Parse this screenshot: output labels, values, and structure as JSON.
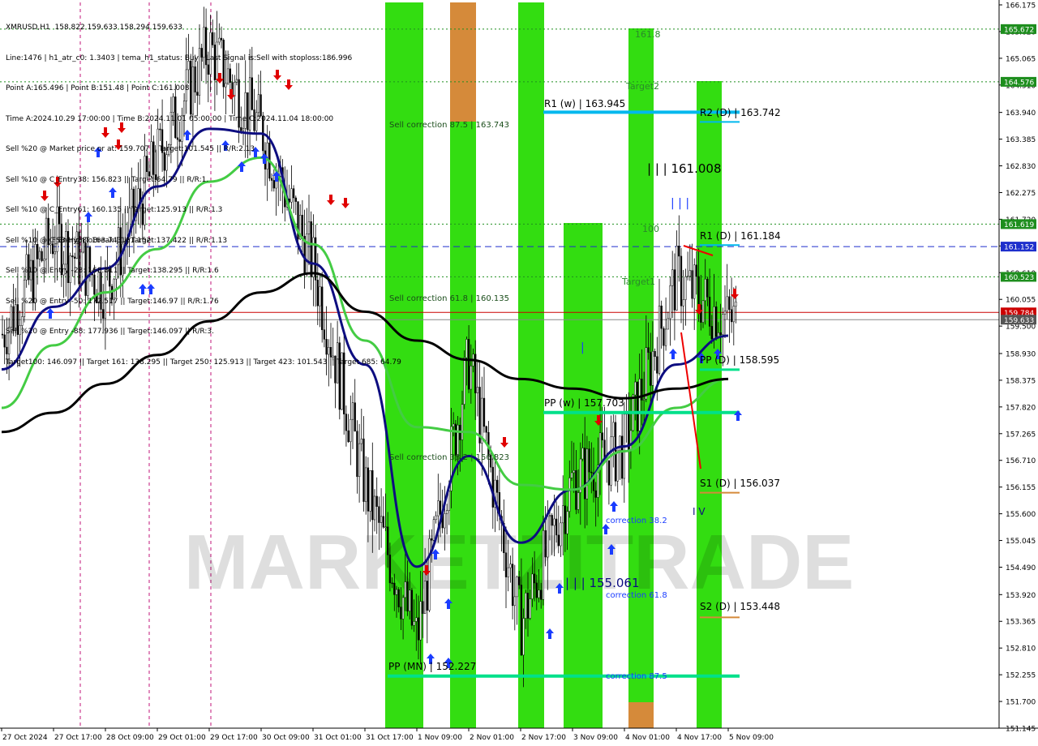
{
  "symbol_header": "XMRUSD,H1  158.822 159.633 158.294 159.633",
  "info_lines": [
    "Line:1476 | h1_atr_c0: 1.3403 | tema_h1_status: Buy | Last Signal is:Sell with stoploss:186.996",
    "Point A:165.496 | Point B:151.48 | Point C:161.008",
    "Time A:2024.10.29 17:00:00 | Time B:2024.11.01 05:00:00 | Time C:2024.11.04 18:00:00",
    "Sell %20 @ Market price or at: 159.707 || Target:101.545 || R/R:2.13",
    "Sell %10 @ C_Entry38: 156.823 || Target:64.79 || R/R:1.",
    "Sell %10 @ C_Entry61: 160.135 || Target:125.913 || R/R:1.3",
    "Sell %10 @ C_Entry88: 163.743 || Target:137.422 || R/R:1.13",
    "Sell %10 @ Entry -23: 168.811 || Target:138.295 || R/R:1.6",
    "Sell %20 @ Entry -50: 172.517 || Target:146.97 || R/R:1.76",
    "Sell %20 @ Entry -88: 177.936 || Target:146.097 || R/R:3.",
    "Target100: 146.097 || Target 161: 138.295 || Target 250: 125.913 || Target 423: 101.543 || Target 685: 64.79"
  ],
  "watermark": "MARKETZITRADE",
  "colors": {
    "up_arrow": "#1a3cff",
    "down_arrow": "#e00000",
    "green_zone": "#33dd11",
    "orange_zone": "#d58a3a",
    "navy_ma": "#0d0d80",
    "green_ma": "#44cc44",
    "black_ma": "#000000",
    "pivot_cyan": "#00b8ee",
    "pivot_green": "#00e08a",
    "level_red": "#cc0000",
    "level_blue_dashed": "#1e2fcc",
    "level_green_dotted": "#1e8e1e"
  },
  "chart_labels": {
    "r1_weekly": "R1 (w) | 163.945",
    "r2_daily": "R2 (D) | 163.742",
    "r1_daily": "R1 (D) | 161.184",
    "pp_daily": "PP (D) | 158.595",
    "pp_weekly": "PP (w) | 157.703",
    "s1_daily": "S1 (D) | 156.037",
    "s2_daily": "S2 (D) | 153.448",
    "pp_monthly": "PP (MN) | 152.227",
    "point_c": "| | | 161.008",
    "point_b": "| | | 155.061",
    "fib_1618": "161.8",
    "target2": "Target2",
    "fib_100": "100",
    "target1": "Target1",
    "sell_corr_875": "Sell correction 87.5 | 163.743",
    "sell_corr_618": "Sell correction 61.8 | 160.135",
    "sell_corr_382": "Sell correction 38.2 | 156.823",
    "fsb": "FSB-HighToBreak | 161.152",
    "corr_382": "correction 38.2",
    "corr_618": "correction 61.8",
    "corr_875": "correction 87.5",
    "marks_c": "| | |",
    "marks_mid": "|",
    "marks_iv": "I V"
  },
  "chart_data": {
    "type": "candlestick",
    "title": "XMRUSD,H1",
    "ylim": [
      151.145,
      166.175
    ],
    "y_ticks": [
      166.175,
      165.62,
      165.065,
      164.51,
      163.94,
      163.385,
      162.83,
      162.275,
      161.72,
      161.165,
      160.61,
      160.055,
      159.5,
      158.93,
      158.375,
      157.82,
      157.265,
      156.71,
      156.155,
      155.6,
      155.045,
      154.49,
      153.92,
      153.365,
      152.81,
      152.255,
      151.7,
      151.145
    ],
    "x_ticks": [
      "27 Oct 2024",
      "27 Oct 17:00",
      "28 Oct 09:00",
      "29 Oct 01:00",
      "29 Oct 17:00",
      "30 Oct 09:00",
      "31 Oct 01:00",
      "31 Oct 17:00",
      "1 Nov 09:00",
      "2 Nov 01:00",
      "2 Nov 17:00",
      "3 Nov 09:00",
      "4 Nov 01:00",
      "4 Nov 17:00",
      "5 Nov 09:00"
    ],
    "horizontal_levels": [
      {
        "label": "165.672",
        "value": 165.672,
        "style": "dotted-green"
      },
      {
        "label": "164.576",
        "value": 164.576,
        "style": "dotted-green"
      },
      {
        "label": "161.619",
        "value": 161.619,
        "style": "dotted-green"
      },
      {
        "label": "161.152",
        "value": 161.152,
        "style": "dashed-blue"
      },
      {
        "label": "160.523",
        "value": 160.523,
        "style": "dotted-green"
      },
      {
        "label": "159.784",
        "value": 159.784,
        "style": "solid-red"
      },
      {
        "label": "159.633",
        "value": 159.633,
        "style": "bid-gray"
      }
    ],
    "price_series": [
      {
        "x": "27 Oct 2024",
        "y": 159.3
      },
      {
        "x": "27 Oct 17:00",
        "y": 161.4
      },
      {
        "x": "28 Oct 09:00",
        "y": 160.3
      },
      {
        "x": "29 Oct 01:00",
        "y": 163.0
      },
      {
        "x": "29 Oct 17:00",
        "y": 165.3
      },
      {
        "x": "30 Oct 09:00",
        "y": 163.6
      },
      {
        "x": "31 Oct 01:00",
        "y": 160.8
      },
      {
        "x": "31 Oct 17:00",
        "y": 156.2
      },
      {
        "x": "1 Nov 09:00",
        "y": 153.0
      },
      {
        "x": "2 Nov 01:00",
        "y": 158.8
      },
      {
        "x": "2 Nov 17:00",
        "y": 153.3
      },
      {
        "x": "3 Nov 09:00",
        "y": 156.3
      },
      {
        "x": "4 Nov 01:00",
        "y": 157.0
      },
      {
        "x": "4 Nov 17:00",
        "y": 160.5
      },
      {
        "x": "5 Nov 09:00",
        "y": 159.633
      }
    ],
    "moving_averages": [
      {
        "name": "fast",
        "color": "navy",
        "values": [
          158.6,
          159.9,
          160.7,
          162.4,
          163.6,
          163.5,
          160.8,
          158.7,
          154.5,
          156.8,
          155.0,
          156.1,
          157.0,
          158.7,
          159.3
        ]
      },
      {
        "name": "medium",
        "color": "green",
        "values": [
          157.8,
          159.1,
          160.2,
          161.1,
          162.5,
          163.0,
          161.2,
          159.2,
          157.4,
          157.3,
          156.2,
          156.1,
          156.9,
          157.8,
          158.4
        ]
      },
      {
        "name": "slow",
        "color": "black",
        "values": [
          157.3,
          157.7,
          158.3,
          158.9,
          159.6,
          160.2,
          160.6,
          159.8,
          159.2,
          158.8,
          158.4,
          158.2,
          158.0,
          158.2,
          158.4
        ]
      }
    ]
  }
}
